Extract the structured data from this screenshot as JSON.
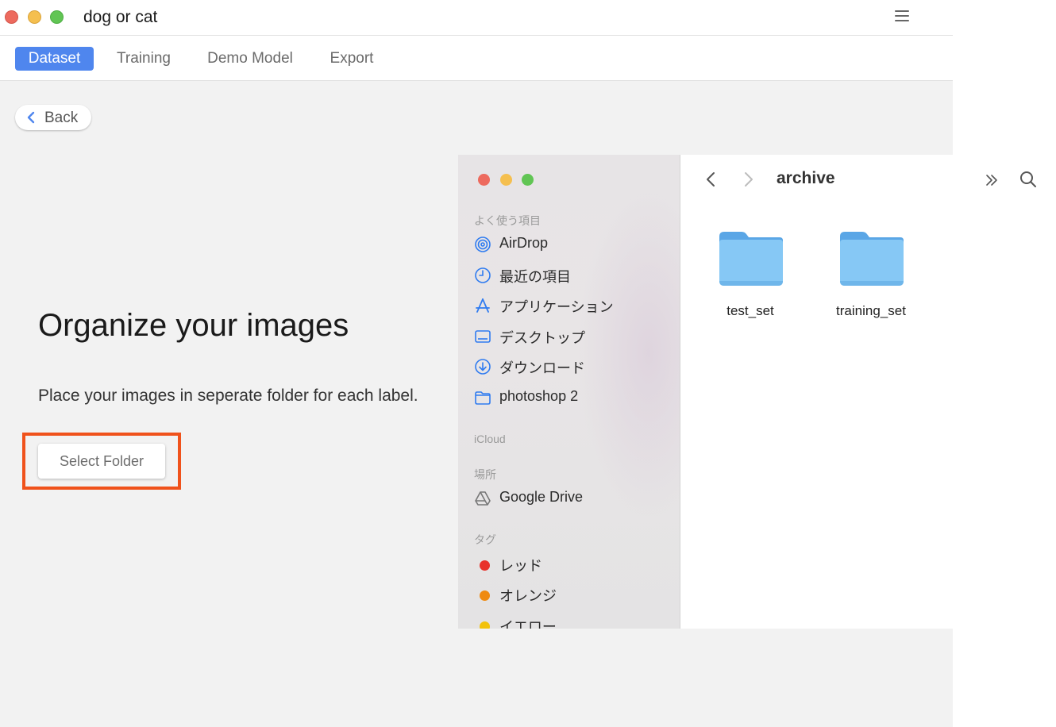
{
  "app": {
    "title": "dog or cat",
    "tabs": [
      {
        "label": "Dataset",
        "active": true
      },
      {
        "label": "Training",
        "active": false
      },
      {
        "label": "Demo Model",
        "active": false
      },
      {
        "label": "Export",
        "active": false
      }
    ],
    "back_label": "Back",
    "heading": "Organize your images",
    "description": "Place your images in seperate folder for each label.",
    "select_button": "Select Folder",
    "accent_color": "#4f86ee",
    "highlight_color": "#f0521b"
  },
  "finder": {
    "current_folder": "archive",
    "sections": {
      "favorites": "よく使う項目",
      "icloud": "iCloud",
      "locations": "場所",
      "tags": "タグ"
    },
    "favorites": [
      {
        "label": "AirDrop",
        "icon": "airdrop-icon"
      },
      {
        "label": "最近の項目",
        "icon": "clock-icon"
      },
      {
        "label": "アプリケーション",
        "icon": "applications-icon"
      },
      {
        "label": "デスクトップ",
        "icon": "desktop-icon"
      },
      {
        "label": "ダウンロード",
        "icon": "download-icon"
      },
      {
        "label": "photoshop 2",
        "icon": "folder-icon"
      }
    ],
    "locations": [
      {
        "label": "Google Drive",
        "icon": "drive-icon"
      }
    ],
    "tags": [
      {
        "label": "レッド",
        "color": "#e8322b"
      },
      {
        "label": "オレンジ",
        "color": "#ef8a10"
      },
      {
        "label": "イエロー",
        "color": "#f2c20b"
      }
    ],
    "items": [
      {
        "label": "test_set",
        "icon": "folder-icon"
      },
      {
        "label": "training_set",
        "icon": "folder-icon"
      }
    ],
    "folder_color": "#86c8f5"
  }
}
